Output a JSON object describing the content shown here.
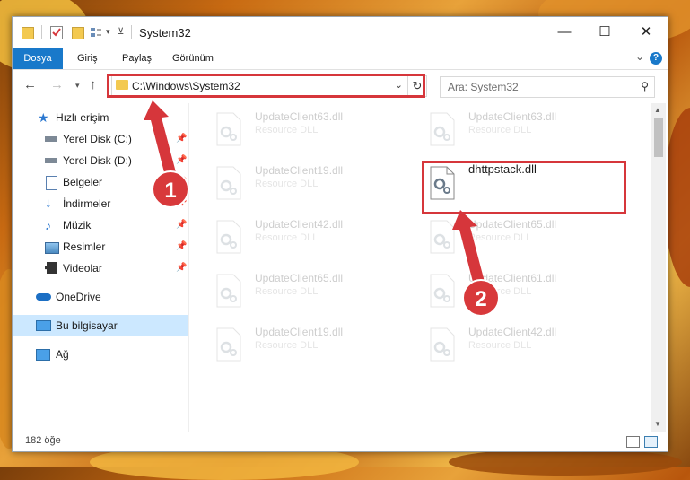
{
  "window": {
    "title": "System32"
  },
  "ribbon": {
    "tabs": [
      "Dosya",
      "Giriş",
      "Paylaş",
      "Görünüm"
    ],
    "help": "?"
  },
  "address": {
    "path": "C:\\Windows\\System32"
  },
  "search": {
    "placeholder": "Ara: System32"
  },
  "sidebar": {
    "items": [
      {
        "label": "Hızlı erişim",
        "icon": "star-icon"
      },
      {
        "label": "Yerel Disk (C:)",
        "icon": "drive-icon",
        "pinned": true
      },
      {
        "label": "Yerel Disk (D:)",
        "icon": "drive-icon",
        "pinned": true
      },
      {
        "label": "Belgeler",
        "icon": "documents-icon",
        "pinned": true
      },
      {
        "label": "İndirmeler",
        "icon": "download-icon",
        "pinned": true
      },
      {
        "label": "Müzik",
        "icon": "music-icon",
        "pinned": true
      },
      {
        "label": "Resimler",
        "icon": "pictures-icon",
        "pinned": true
      },
      {
        "label": "Videolar",
        "icon": "videos-icon",
        "pinned": true
      },
      {
        "label": "OneDrive",
        "icon": "cloud-icon"
      },
      {
        "label": "Bu bilgisayar",
        "icon": "computer-icon",
        "selected": true
      },
      {
        "label": "Ağ",
        "icon": "network-icon"
      }
    ]
  },
  "files": {
    "col1": [
      {
        "name": "UpdateClient63.dll",
        "type": "Resource DLL"
      },
      {
        "name": "UpdateClient19.dll",
        "type": "Resource DLL"
      },
      {
        "name": "UpdateClient42.dll",
        "type": "Resource DLL"
      },
      {
        "name": "UpdateClient65.dll",
        "type": "Resource DLL"
      },
      {
        "name": "UpdateClient19.dll",
        "type": "Resource DLL"
      }
    ],
    "col2": [
      {
        "name": "UpdateClient63.dll",
        "type": "Resource DLL"
      },
      {
        "name": "dhttpstack.dll",
        "type": ""
      },
      {
        "name": "UpdateClient65.dll",
        "type": "Resource DLL"
      },
      {
        "name": "UpdateClient61.dll",
        "type": "Resource DLL"
      },
      {
        "name": "UpdateClient42.dll",
        "type": "Resource DLL"
      }
    ]
  },
  "status": {
    "count": "182 öğe"
  },
  "annotations": {
    "badge1": "1",
    "badge2": "2",
    "color": "#d6363b"
  }
}
